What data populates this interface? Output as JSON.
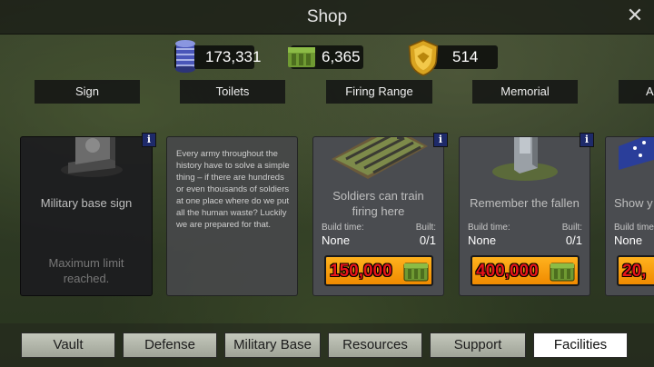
{
  "window": {
    "title": "Shop"
  },
  "resources": [
    {
      "icon": "spool-icon",
      "value": "173,331"
    },
    {
      "icon": "supply-crate-icon",
      "value": "6,365"
    },
    {
      "icon": "gold-medal-icon",
      "value": "514"
    }
  ],
  "items": [
    {
      "tab": "Sign",
      "title": "Military base sign",
      "status": "Maximum limit reached."
    },
    {
      "tab": "Toilets",
      "description": "Every army throughout the history have to solve a simple thing – if there are hundreds or even thousands of soldiers at one place where do we put all the human waste? Luckily we are prepared for that."
    },
    {
      "tab": "Firing Range",
      "title": "Soldiers can train firing here",
      "build_time_label": "Build time:",
      "build_time": "None",
      "built_label": "Built:",
      "built": "0/1",
      "price": "150,000"
    },
    {
      "tab": "Memorial",
      "title": "Remember the fallen",
      "build_time_label": "Build time:",
      "build_time": "None",
      "built_label": "Built:",
      "built": "0/1",
      "price": "400,000"
    },
    {
      "tab": "A",
      "title": "Show y",
      "build_time_label": "Build time:",
      "build_time": "None",
      "price": "20,"
    }
  ],
  "info_label": "i",
  "close_label": "✕",
  "bottom_tabs": [
    "Vault",
    "Defense",
    "Military Base",
    "Resources",
    "Support",
    "Facilities"
  ],
  "active_tab": "Facilities",
  "colors": {
    "price_text": "#e8141a",
    "buy_button": "#f5a00e",
    "info_button": "#1e2a6a"
  }
}
